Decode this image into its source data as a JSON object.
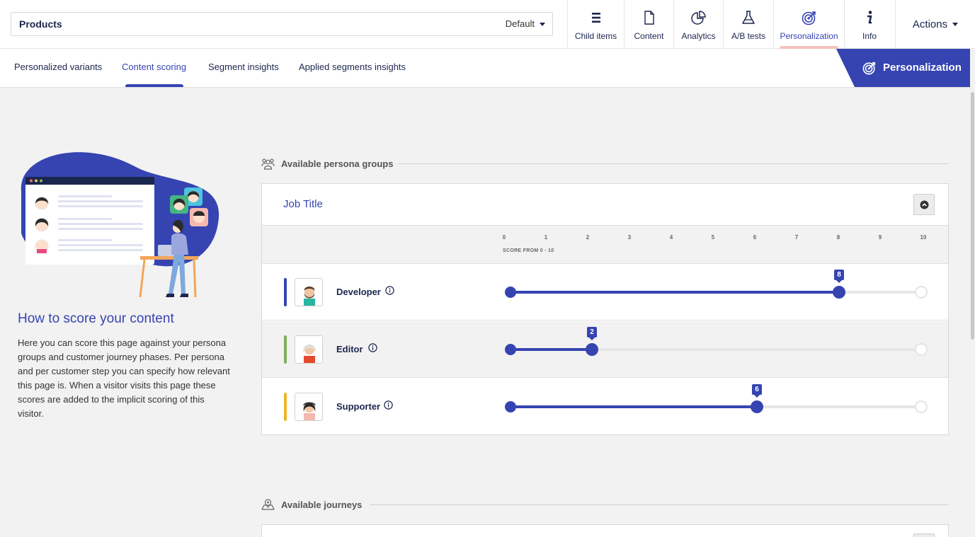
{
  "header": {
    "node_name": "Products",
    "variant": "Default",
    "apps": [
      {
        "label": "Child items",
        "icon": "list-icon"
      },
      {
        "label": "Content",
        "icon": "document-icon"
      },
      {
        "label": "Analytics",
        "icon": "pie-chart-icon"
      },
      {
        "label": "A/B tests",
        "icon": "flask-icon"
      },
      {
        "label": "Personalization",
        "icon": "target-icon",
        "active": true
      },
      {
        "label": "Info",
        "icon": "info-icon"
      }
    ],
    "actions_label": "Actions"
  },
  "subtabs": {
    "items": [
      {
        "label": "Personalized variants"
      },
      {
        "label": "Content scoring",
        "active": true
      },
      {
        "label": "Segment insights"
      },
      {
        "label": "Applied segments insights"
      }
    ],
    "badge_label": "Personalization"
  },
  "help": {
    "title": "How to score your content",
    "text": "Here you can score this page against your persona groups and customer journey phases. Per persona and per customer step you can specify how relevant this page is. When a visitor visits this page these scores are added to the implicit scoring of this visitor."
  },
  "persona_section": {
    "label": "Available persona groups",
    "group": {
      "title": "Job Title",
      "scale": [
        "0",
        "1",
        "2",
        "3",
        "4",
        "5",
        "6",
        "7",
        "8",
        "9",
        "10"
      ],
      "scale_caption": "SCORE FROM 0 - 10",
      "max": 10,
      "personas": [
        {
          "name": "Developer",
          "score": 8,
          "color": "#3544b1"
        },
        {
          "name": "Editor",
          "score": 2,
          "color": "#7fae5c"
        },
        {
          "name": "Supporter",
          "score": 6,
          "color": "#f0b429"
        }
      ]
    }
  },
  "journey_section": {
    "label": "Available journeys"
  },
  "colors": {
    "accent": "#3544b1",
    "navy": "#1b264f",
    "active_tab_indicator": "#f5c1bc"
  }
}
